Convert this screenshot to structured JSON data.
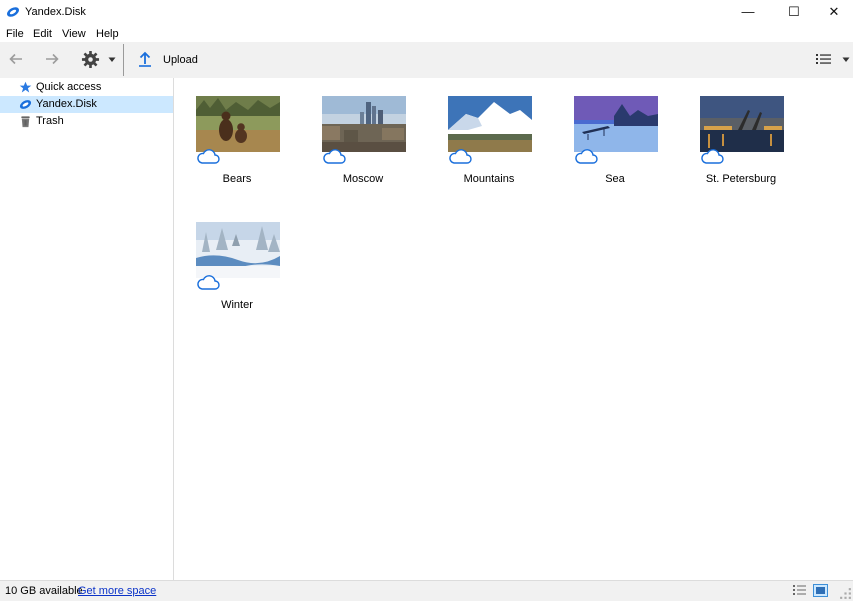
{
  "window": {
    "title": "Yandex.Disk",
    "minimize": "—",
    "maximize": "☐",
    "close": "✕"
  },
  "menu": [
    "File",
    "Edit",
    "View",
    "Help"
  ],
  "toolbar": {
    "back_icon": "arrow-left-icon",
    "forward_icon": "arrow-right-icon",
    "settings_icon": "gear-icon",
    "upload_label": "Upload",
    "view_menu_icon": "list-view-icon"
  },
  "sidebar": {
    "items": [
      {
        "label": "Quick access",
        "icon": "star-icon",
        "selected": false
      },
      {
        "label": "Yandex.Disk",
        "icon": "yandex-disk-icon",
        "selected": true
      },
      {
        "label": "Trash",
        "icon": "trash-icon",
        "selected": false
      }
    ]
  },
  "files": [
    {
      "name": "Bears",
      "thumb": "bears"
    },
    {
      "name": "Moscow",
      "thumb": "moscow"
    },
    {
      "name": "Mountains",
      "thumb": "mountains"
    },
    {
      "name": "Sea",
      "thumb": "sea"
    },
    {
      "name": "St. Petersburg",
      "thumb": "st-petersburg"
    },
    {
      "name": "Winter",
      "thumb": "winter"
    }
  ],
  "status": {
    "available": "10 GB available",
    "link": "Get more space"
  },
  "colors": {
    "accent": "#1a6fdc",
    "selection": "#cce8ff",
    "toolbar_bg": "#f1f1f1",
    "link": "#0b33c8"
  }
}
